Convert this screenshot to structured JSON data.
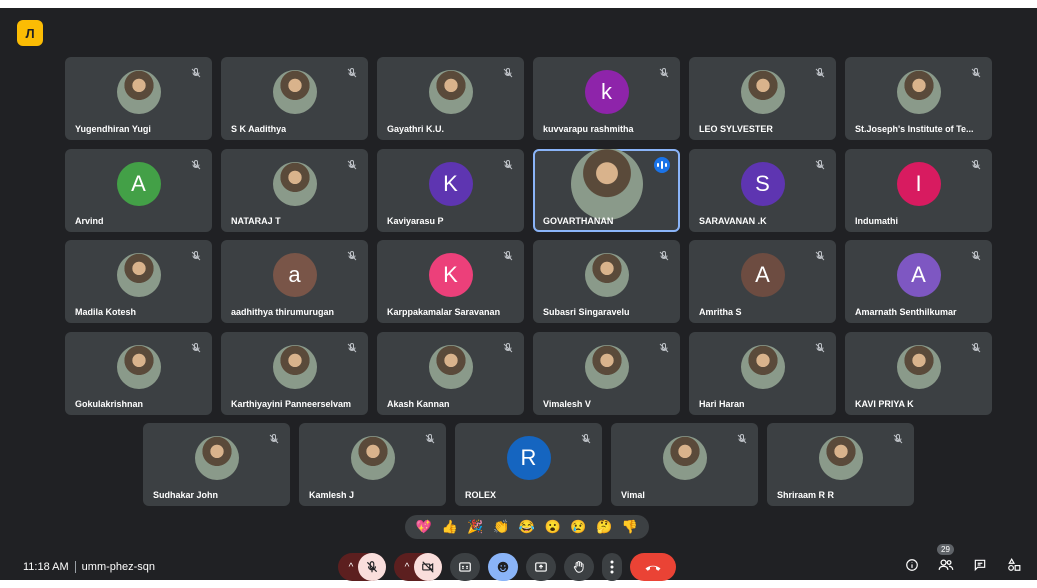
{
  "app": {
    "logo_glyph": "Л"
  },
  "meeting": {
    "time": "11:18 AM",
    "code": "umm-phez-sqn",
    "participant_count": "29"
  },
  "colors": {
    "background": "#202124",
    "tile": "#3c4043",
    "active_outline": "#8ab4f8",
    "end_call": "#ea4335",
    "logo": "#fbbc04"
  },
  "rows": [
    [
      {
        "name": "Yugendhiran Yugi",
        "type": "photo"
      },
      {
        "name": "S K Aadithya",
        "type": "photo"
      },
      {
        "name": "Gayathri K.U.",
        "type": "photo"
      },
      {
        "name": "kuvvarapu rashmitha",
        "type": "letter",
        "letter": "k",
        "color": "#8e24aa"
      },
      {
        "name": "LEO SYLVESTER",
        "type": "photo"
      },
      {
        "name": "St.Joseph's Institute of Te...",
        "type": "photo"
      }
    ],
    [
      {
        "name": "Arvind",
        "type": "letter",
        "letter": "A",
        "color": "#43a047"
      },
      {
        "name": "NATARAJ T",
        "type": "photo"
      },
      {
        "name": "Kaviyarasu P",
        "type": "letter",
        "letter": "K",
        "color": "#5e35b1"
      },
      {
        "name": "GOVARTHANAN",
        "type": "photo",
        "active": true
      },
      {
        "name": "SARAVANAN .K",
        "type": "letter",
        "letter": "S",
        "color": "#5e35b1"
      },
      {
        "name": "Indumathi",
        "type": "letter",
        "letter": "I",
        "color": "#d81b60"
      }
    ],
    [
      {
        "name": "Madila Kotesh",
        "type": "photo"
      },
      {
        "name": "aadhithya thirumurugan",
        "type": "letter",
        "letter": "a",
        "color": "#795548"
      },
      {
        "name": "Karppakamalar Saravanan",
        "type": "letter",
        "letter": "K",
        "color": "#ec407a"
      },
      {
        "name": "Subasri Singaravelu",
        "type": "photo"
      },
      {
        "name": "Amritha S",
        "type": "letter",
        "letter": "A",
        "color": "#6d4c41"
      },
      {
        "name": "Amarnath Senthilkumar",
        "type": "letter",
        "letter": "A",
        "color": "#7e57c2"
      }
    ],
    [
      {
        "name": "Gokulakrishnan",
        "type": "photo"
      },
      {
        "name": "Karthiyayini Panneerselvam",
        "type": "photo"
      },
      {
        "name": "Akash Kannan",
        "type": "photo"
      },
      {
        "name": "Vimalesh V",
        "type": "photo"
      },
      {
        "name": "Hari Haran",
        "type": "photo"
      },
      {
        "name": "KAVI PRIYA K",
        "type": "photo"
      }
    ],
    [
      {
        "name": "Sudhakar John",
        "type": "photo"
      },
      {
        "name": "Kamlesh J",
        "type": "photo"
      },
      {
        "name": "ROLEX",
        "type": "letter",
        "letter": "R",
        "color": "#1565c0"
      },
      {
        "name": "Vimal",
        "type": "photo"
      },
      {
        "name": "Shriraam R R",
        "type": "photo"
      }
    ]
  ],
  "reactions": [
    "💖",
    "👍",
    "🎉",
    "👏",
    "😂",
    "😮",
    "😢",
    "🤔",
    "👎"
  ],
  "icons": {
    "mic_off": "mic-off-icon",
    "cam_off": "videocam-off-icon",
    "captions": "captions-icon",
    "emoji": "emoji-icon",
    "present": "present-icon",
    "hand": "raise-hand-icon",
    "more": "more-vert-icon",
    "end": "call-end-icon",
    "info": "info-icon",
    "people": "people-icon",
    "chat": "chat-icon",
    "activities": "activities-icon"
  }
}
